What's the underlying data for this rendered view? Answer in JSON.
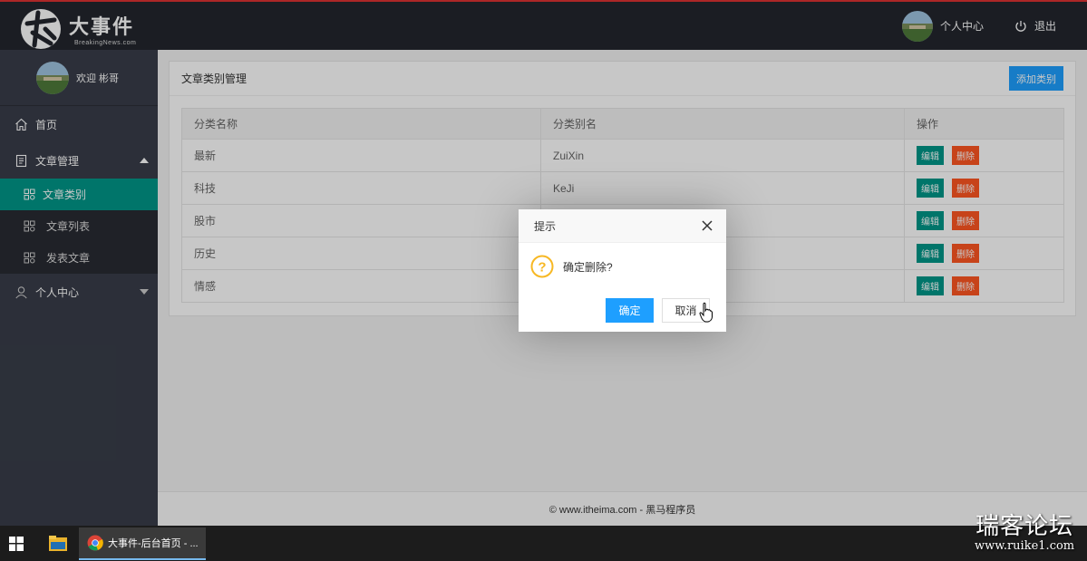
{
  "header": {
    "logo_title": "大事件",
    "logo_sub": "BreakingNews.com",
    "personal_center": "个人中心",
    "logout": "退出"
  },
  "sidebar": {
    "welcome": "欢迎 彬哥",
    "items": [
      {
        "label": "首页",
        "icon": "home-icon"
      },
      {
        "label": "文章管理",
        "icon": "document-icon",
        "expanded": true,
        "children": [
          {
            "label": "文章类别",
            "active": true
          },
          {
            "label": "文章列表"
          },
          {
            "label": "发表文章"
          }
        ]
      },
      {
        "label": "个人中心",
        "icon": "user-icon",
        "expanded": false
      }
    ]
  },
  "main": {
    "card_title": "文章类别管理",
    "add_button": "添加类别",
    "table": {
      "headers": [
        "分类名称",
        "分类别名",
        "操作"
      ],
      "rows": [
        {
          "name": "最新",
          "alias": "ZuiXin"
        },
        {
          "name": "科技",
          "alias": "KeJi"
        },
        {
          "name": "股市",
          "alias": ""
        },
        {
          "name": "历史",
          "alias": ""
        },
        {
          "name": "情感",
          "alias": ""
        }
      ],
      "edit_label": "编辑",
      "delete_label": "删除"
    }
  },
  "footer": {
    "text": "© www.itheima.com - 黑马程序员"
  },
  "dialog": {
    "title": "提示",
    "message": "确定删除?",
    "ok": "确定",
    "cancel": "取消"
  },
  "taskbar": {
    "chrome_tab": "大事件-后台首页 - ..."
  },
  "watermark": {
    "cn": "瑞客论坛",
    "url": "www.ruike1.com"
  },
  "colors": {
    "header_bg": "#23262e",
    "sidebar_bg": "#393d49",
    "active_item": "#009688",
    "primary_blue": "#1e9fff",
    "danger_orange": "#ff5722"
  }
}
